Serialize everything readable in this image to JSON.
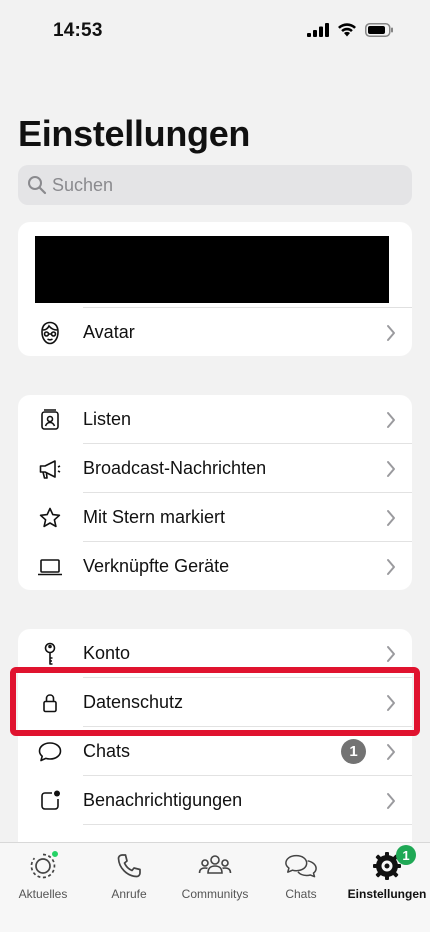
{
  "status_bar": {
    "time": "14:53",
    "icons": [
      "cellular-signal-icon",
      "wifi-icon",
      "battery-icon"
    ]
  },
  "page": {
    "title": "Einstellungen"
  },
  "search": {
    "placeholder": "Suchen"
  },
  "profile": {
    "items": [
      {
        "label": "Avatar",
        "icon": "avatar-face-icon"
      }
    ]
  },
  "tools": {
    "items": [
      {
        "label": "Listen",
        "icon": "contact-list-icon"
      },
      {
        "label": "Broadcast-Nachrichten",
        "icon": "megaphone-icon"
      },
      {
        "label": "Mit Stern markiert",
        "icon": "star-icon"
      },
      {
        "label": "Verknüpfte Geräte",
        "icon": "laptop-icon"
      }
    ]
  },
  "settings": {
    "items": [
      {
        "label": "Konto",
        "icon": "key-icon"
      },
      {
        "label": "Datenschutz",
        "icon": "lock-icon"
      },
      {
        "label": "Chats",
        "icon": "chat-bubble-icon",
        "badge": "1"
      },
      {
        "label": "Benachrichtigungen",
        "icon": "notification-icon"
      }
    ]
  },
  "highlight": {
    "target": "Datenschutz",
    "color": "#e0132f"
  },
  "tab_bar": {
    "tabs": [
      {
        "label": "Aktuelles",
        "icon": "status-icon",
        "dot": true
      },
      {
        "label": "Anrufe",
        "icon": "phone-icon"
      },
      {
        "label": "Communitys",
        "icon": "communities-icon"
      },
      {
        "label": "Chats",
        "icon": "chats-icon"
      },
      {
        "label": "Einstellungen",
        "icon": "settings-gear-icon",
        "badge": "1",
        "active": true
      }
    ]
  },
  "colors": {
    "accent_green": "#25d366",
    "badge_grey": "#737373",
    "background": "#f2f2f2"
  }
}
